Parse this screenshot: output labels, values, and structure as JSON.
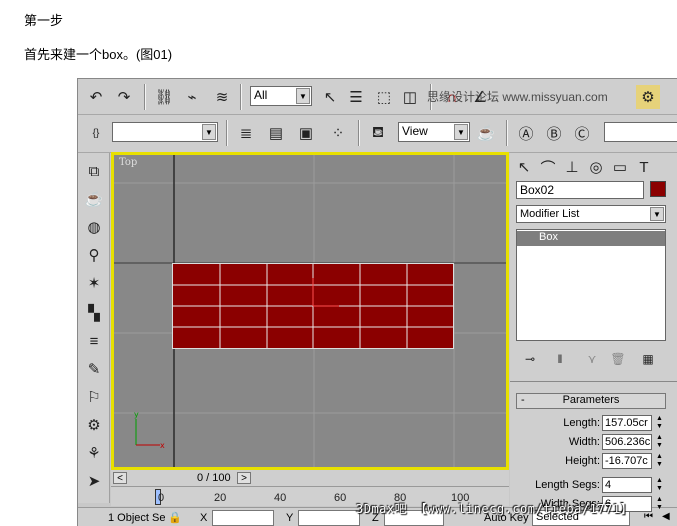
{
  "article": {
    "heading": "第一步",
    "intro": "首先来建一个box。(图01)"
  },
  "toolbar1": {
    "selection_filter": "All"
  },
  "toolbar2": {
    "coord_system": "View"
  },
  "viewport": {
    "label": "Top",
    "object_color": "#8b0000"
  },
  "timeline": {
    "frame_text": "0 / 100",
    "ticks": [
      "0",
      "20",
      "40",
      "60",
      "80",
      "100"
    ]
  },
  "command_panel": {
    "object_name": "Box02",
    "modifier_list": "Modifier List",
    "stack_items": [
      "Box"
    ],
    "params_title": "Parameters",
    "params": [
      {
        "label": "Length:",
        "value": "157.05cr"
      },
      {
        "label": "Width:",
        "value": "506.236c"
      },
      {
        "label": "Height:",
        "value": "-16.707c"
      },
      {
        "label": "Length Segs:",
        "value": "4"
      },
      {
        "label": "Width Segs:",
        "value": "6"
      }
    ]
  },
  "status_bar": {
    "selection_count": "1 Object Se",
    "x_label": "X",
    "y_label": "Y",
    "z_label": "Z",
    "auto_key": "Auto Key",
    "selected": "Selected"
  },
  "watermarks": {
    "top": "思缘设计论坛 www.missyuan.com",
    "bottom": "3Dmax吧 【www.linecg.com/tieba/1771】"
  }
}
